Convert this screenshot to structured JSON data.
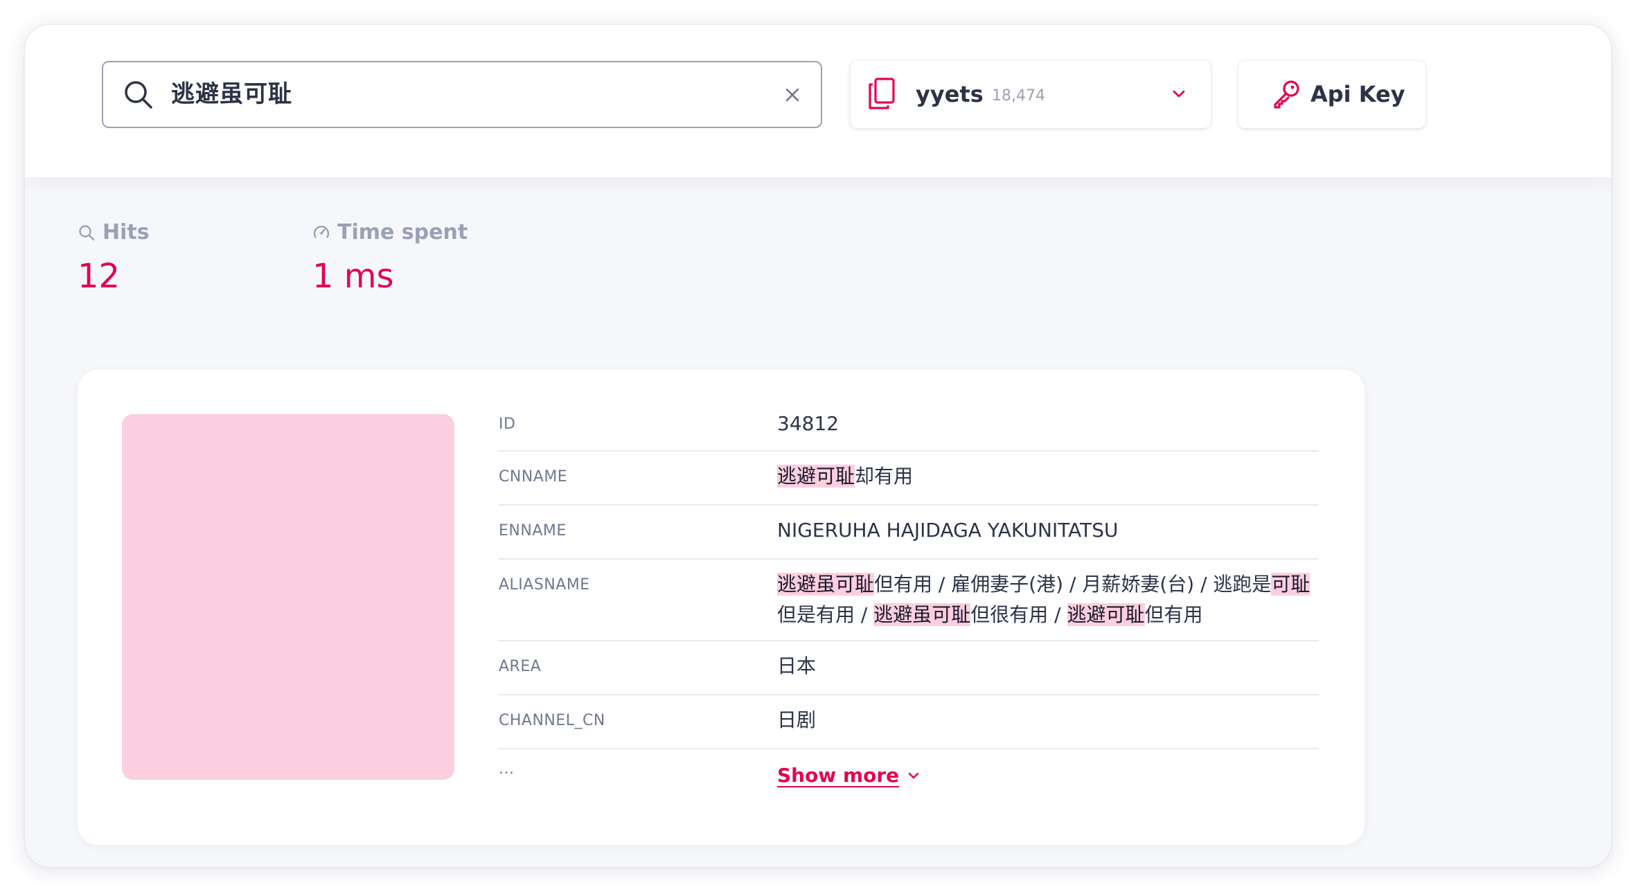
{
  "search": {
    "value": "逃避虽可耻",
    "icon": "search-icon",
    "clear_icon": "close-icon"
  },
  "index_selector": {
    "icon": "copy-documents-icon",
    "name": "yyets",
    "count": "18,474",
    "chevron_icon": "chevron-down-icon"
  },
  "api_key": {
    "icon": "key-icon",
    "label": "Api Key"
  },
  "stats": {
    "hits": {
      "label": "Hits",
      "value": "12",
      "icon": "search-icon"
    },
    "time": {
      "label": "Time spent",
      "value": "1 ms",
      "icon": "speedometer-icon"
    }
  },
  "result": {
    "poster_color": "#fbcfdf",
    "fields": {
      "id": {
        "key": "ID",
        "value": "34812"
      },
      "cnname": {
        "key": "CNNAME",
        "hl": "逃避可耻",
        "rest": "却有用"
      },
      "enname": {
        "key": "ENNAME",
        "value": "NIGERUHA HAJIDAGA YAKUNITATSU"
      },
      "aliasname": {
        "key": "ALIASNAME",
        "hl1": "逃避虽可耻",
        "t1": "但有用 / 雇佣妻子(港) / 月薪娇妻(台) / 逃跑是",
        "hl2": "可耻",
        "t2": "但是有用 / ",
        "hl3": "逃避虽可耻",
        "t3": "但很有用 / ",
        "hl4": "逃避可耻",
        "t4": "但有用"
      },
      "area": {
        "key": "AREA",
        "value": "日本"
      },
      "channel_cn": {
        "key": "CHANNEL_CN",
        "value": "日剧"
      },
      "more": {
        "key": "...",
        "label": "Show more"
      }
    }
  },
  "colors": {
    "accent": "#e2044f",
    "highlight": "#fbcfdf",
    "text": "#2c3347",
    "muted": "#9aa1b4"
  }
}
